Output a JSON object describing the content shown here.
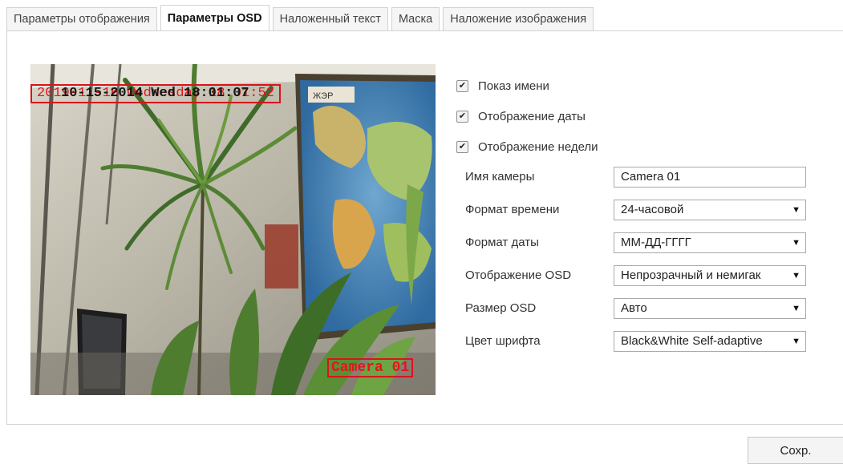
{
  "tabs": [
    {
      "label": "Параметры отображения",
      "active": false
    },
    {
      "label": "Параметры OSD",
      "active": true
    },
    {
      "label": "Наложенный текст",
      "active": false
    },
    {
      "label": "Маска",
      "active": false
    },
    {
      "label": "Наложение изображения",
      "active": false
    }
  ],
  "preview": {
    "osd_date_text": "2019-11-16 Wednesday 18:01:52",
    "osd_date_overlap": "10-15-2014 Wed 18:01:07",
    "osd_camera_text": "Camera 01",
    "map_label": "ЖЭР"
  },
  "checkboxes": [
    {
      "label": "Показ имени",
      "checked": true
    },
    {
      "label": "Отображение даты",
      "checked": true
    },
    {
      "label": "Отображение недели",
      "checked": true
    }
  ],
  "form": {
    "camera_name": {
      "label": "Имя камеры",
      "value": "Camera 01"
    },
    "time_format": {
      "label": "Формат времени",
      "value": "24-часовой"
    },
    "date_format": {
      "label": "Формат даты",
      "value": "ММ-ДД-ГГГГ"
    },
    "osd_display": {
      "label": "Отображение OSD",
      "value": "Непрозрачный и немигак"
    },
    "osd_size": {
      "label": "Размер OSD",
      "value": "Авто"
    },
    "font_color": {
      "label": "Цвет шрифта",
      "value": "Black&White Self-adaptive"
    }
  },
  "save_label": "Сохр.",
  "icons": {
    "checkbox": "check-icon",
    "dropdown": "dropdown-arrow-icon"
  },
  "colors": {
    "osd_red": "#d8141c",
    "tab_border": "#d2d2d2"
  }
}
